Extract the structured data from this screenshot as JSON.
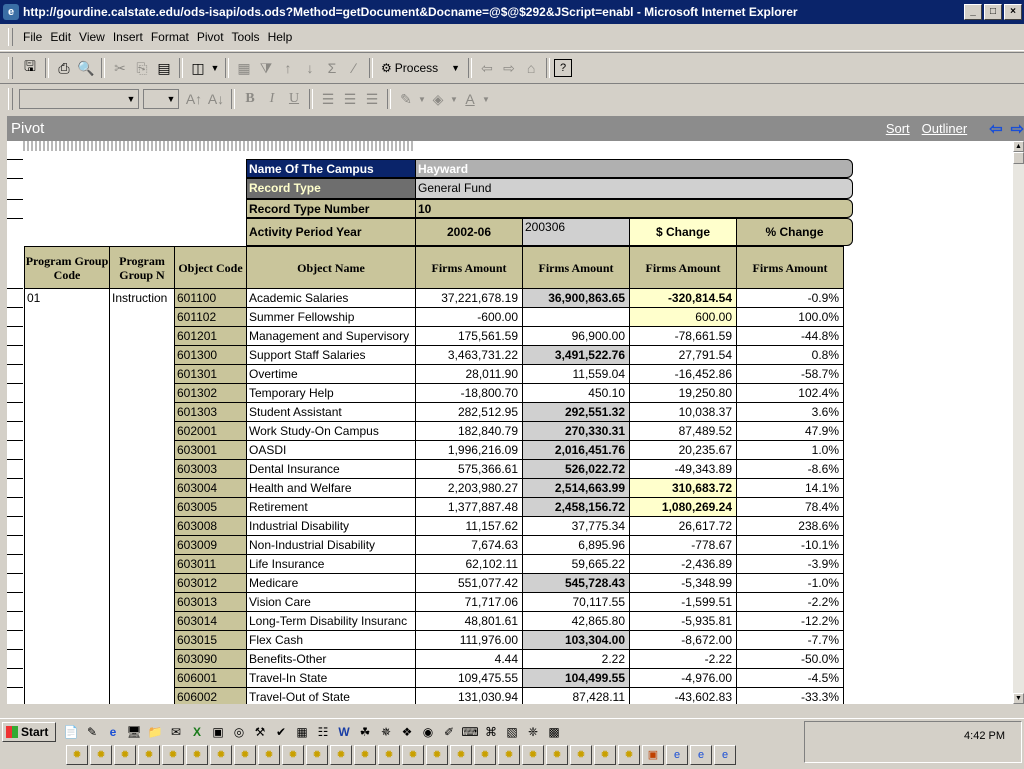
{
  "window": {
    "title": "http://gourdine.calstate.edu/ods-isapi/ods.ods?Method=getDocument&Docname=@$@$292&JScript=enabl - Microsoft Internet Explorer",
    "controls": [
      "_",
      "□",
      "×"
    ]
  },
  "menu": [
    "File",
    "Edit",
    "View",
    "Insert",
    "Format",
    "Pivot",
    "Tools",
    "Help"
  ],
  "toolbar": {
    "process_label": "Process"
  },
  "pivot": {
    "title": "Pivot",
    "sort_link": "Sort",
    "outliner_link": "Outliner"
  },
  "filters": {
    "campus_label": "Name Of The Campus",
    "campus_value": "Hayward",
    "record_type_label": "Record Type",
    "record_type_value": "General Fund",
    "record_type_number_label": "Record Type Number",
    "record_type_number_value": "10",
    "period_label": "Activity Period Year",
    "period_1": "2002-06",
    "period_2": "200306",
    "dollar_change": "$ Change",
    "pct_change": "% Change"
  },
  "columns": {
    "program_group_code": "Program Group Code",
    "program_group": "Program Group N",
    "object_code": "Object Code",
    "object_name": "Object Name",
    "firms_amount": "Firms Amount"
  },
  "group": {
    "code": "01",
    "name": "Instruction"
  },
  "rows": [
    {
      "code": "601100",
      "name": "Academic Salaries",
      "a": "37,221,678.19",
      "b": "36,900,863.65",
      "c": "-320,814.54",
      "d": "-0.9%",
      "bb": true,
      "cy": true
    },
    {
      "code": "601102",
      "name": "Summer Fellowship",
      "a": "-600.00",
      "b": "",
      "c": "600.00",
      "d": "100.0%",
      "bb": false,
      "cy": false
    },
    {
      "code": "601201",
      "name": "Management and Supervisory",
      "a": "175,561.59",
      "b": "96,900.00",
      "c": "-78,661.59",
      "d": "-44.8%",
      "bb": false,
      "cy": false
    },
    {
      "code": "601300",
      "name": "Support Staff Salaries",
      "a": "3,463,731.22",
      "b": "3,491,522.76",
      "c": "27,791.54",
      "d": "0.8%",
      "bb": true,
      "cy": false
    },
    {
      "code": "601301",
      "name": "Overtime",
      "a": "28,011.90",
      "b": "11,559.04",
      "c": "-16,452.86",
      "d": "-58.7%",
      "bb": false,
      "cy": false
    },
    {
      "code": "601302",
      "name": "Temporary Help",
      "a": "-18,800.70",
      "b": "450.10",
      "c": "19,250.80",
      "d": "102.4%",
      "bb": false,
      "cy": false
    },
    {
      "code": "601303",
      "name": "Student Assistant",
      "a": "282,512.95",
      "b": "292,551.32",
      "c": "10,038.37",
      "d": "3.6%",
      "bb": true,
      "cy": false
    },
    {
      "code": "602001",
      "name": "Work Study-On Campus",
      "a": "182,840.79",
      "b": "270,330.31",
      "c": "87,489.52",
      "d": "47.9%",
      "bb": true,
      "cy": false
    },
    {
      "code": "603001",
      "name": "OASDI",
      "a": "1,996,216.09",
      "b": "2,016,451.76",
      "c": "20,235.67",
      "d": "1.0%",
      "bb": true,
      "cy": false
    },
    {
      "code": "603003",
      "name": "Dental Insurance",
      "a": "575,366.61",
      "b": "526,022.72",
      "c": "-49,343.89",
      "d": "-8.6%",
      "bb": true,
      "cy": false
    },
    {
      "code": "603004",
      "name": "Health and Welfare",
      "a": "2,203,980.27",
      "b": "2,514,663.99",
      "c": "310,683.72",
      "d": "14.1%",
      "bb": true,
      "cy": true
    },
    {
      "code": "603005",
      "name": "Retirement",
      "a": "1,377,887.48",
      "b": "2,458,156.72",
      "c": "1,080,269.24",
      "d": "78.4%",
      "bb": true,
      "cy": true
    },
    {
      "code": "603008",
      "name": "Industrial Disability",
      "a": "11,157.62",
      "b": "37,775.34",
      "c": "26,617.72",
      "d": "238.6%",
      "bb": false,
      "cy": false
    },
    {
      "code": "603009",
      "name": "Non-Industrial Disability",
      "a": "7,674.63",
      "b": "6,895.96",
      "c": "-778.67",
      "d": "-10.1%",
      "bb": false,
      "cy": false
    },
    {
      "code": "603011",
      "name": "Life Insurance",
      "a": "62,102.11",
      "b": "59,665.22",
      "c": "-2,436.89",
      "d": "-3.9%",
      "bb": false,
      "cy": false
    },
    {
      "code": "603012",
      "name": "Medicare",
      "a": "551,077.42",
      "b": "545,728.43",
      "c": "-5,348.99",
      "d": "-1.0%",
      "bb": true,
      "cy": false
    },
    {
      "code": "603013",
      "name": "Vision Care",
      "a": "71,717.06",
      "b": "70,117.55",
      "c": "-1,599.51",
      "d": "-2.2%",
      "bb": false,
      "cy": false
    },
    {
      "code": "603014",
      "name": "Long-Term Disability Insuranc",
      "a": "48,801.61",
      "b": "42,865.80",
      "c": "-5,935.81",
      "d": "-12.2%",
      "bb": false,
      "cy": false
    },
    {
      "code": "603015",
      "name": "Flex Cash",
      "a": "111,976.00",
      "b": "103,304.00",
      "c": "-8,672.00",
      "d": "-7.7%",
      "bb": true,
      "cy": false
    },
    {
      "code": "603090",
      "name": "Benefits-Other",
      "a": "4.44",
      "b": "2.22",
      "c": "-2.22",
      "d": "-50.0%",
      "bb": false,
      "cy": false
    },
    {
      "code": "606001",
      "name": "Travel-In State",
      "a": "109,475.55",
      "b": "104,499.55",
      "c": "-4,976.00",
      "d": "-4.5%",
      "bb": true,
      "cy": false
    },
    {
      "code": "606002",
      "name": "Travel-Out of State",
      "a": "131,030.94",
      "b": "87,428.11",
      "c": "-43,602.83",
      "d": "-33.3%",
      "bb": false,
      "cy": false
    }
  ],
  "taskbar": {
    "start_label": "Start",
    "clock": "4:42 PM"
  }
}
